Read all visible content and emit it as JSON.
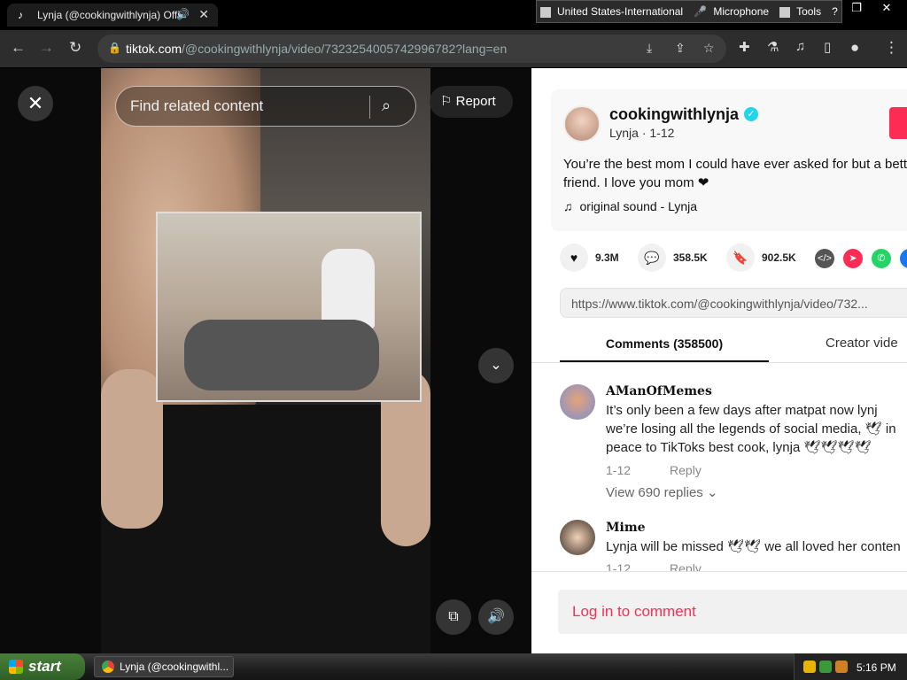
{
  "browser": {
    "tab_title": "Lynja (@cookingwithlynja) Offi",
    "url_host": "tiktok.com",
    "url_path": "/@cookingwithlynja/video/7323254005742996782?lang=en",
    "language_bar": {
      "layout": "United States-International",
      "microphone": "Microphone",
      "tools": "Tools"
    }
  },
  "video": {
    "search_placeholder": "Find related content",
    "report_label": "Report"
  },
  "post": {
    "username": "cookingwithlynja",
    "display_name": "Lynja",
    "date": "1-12",
    "subline": "Lynja · 1-12",
    "caption": "You’re the best mom I could have ever asked for but a better friend. I love you mom ❤",
    "sound": "original sound - Lynja",
    "likes": "9.3M",
    "comments": "358.5K",
    "saves": "902.5K",
    "link": "https://www.tiktok.com/@cookingwithlynja/video/732..."
  },
  "tabs": {
    "comments_label": "Comments (358500)",
    "creator_label": "Creator vide"
  },
  "comments": [
    {
      "author": "AManOfMemes",
      "text": "It’s only been a few days after matpat now lynj we’re losing all the legends of social media, 🕊 in peace to TikToks best cook, lynja 🕊🕊🕊🕊",
      "date": "1-12",
      "reply": "Reply",
      "view_replies": "View 690 replies"
    },
    {
      "author": "Mime",
      "text": "Lynja will be missed 🕊🕊 we all loved her conten",
      "date": "1-12",
      "reply": "Reply"
    }
  ],
  "login_label": "Log in to comment",
  "taskbar": {
    "start_label": "start",
    "task_label": "Lynja (@cookingwithl...",
    "clock": "5:16 PM"
  },
  "colors": {
    "tiktok_red": "#fe2c55",
    "verified_blue": "#20d5ec"
  }
}
